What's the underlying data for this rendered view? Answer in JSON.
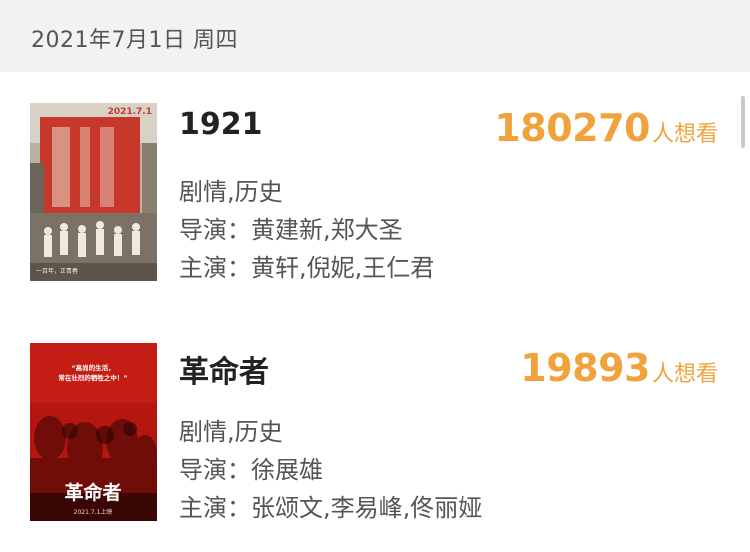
{
  "header": {
    "date": "2021年7月1日 周四"
  },
  "movies": [
    {
      "title": "1921",
      "want_count": "180270",
      "want_unit": "人想看",
      "genre": "剧情,历史",
      "director": "导演：黄建新,郑大圣",
      "cast": "主演：黄轩,倪妮,王仁君",
      "poster_text": {
        "date": "2021.7.1",
        "tag": "一百年，正青春"
      }
    },
    {
      "title": "革命者",
      "want_count": "19893",
      "want_unit": "人想看",
      "genre": "剧情,历史",
      "director": "导演：徐展雄",
      "cast": "主演：张颂文,李易峰,佟丽娅",
      "poster_text": {
        "title": "革命者",
        "quote1": "“高尚的生活，",
        "quote2": "常在壮烈的牺牲之中！”",
        "date": "2021.7.1上映"
      }
    }
  ],
  "colors": {
    "accent": "#f0a33c",
    "header_bg": "#f2f2f2",
    "text_dark": "#222222",
    "text_gray": "#555555"
  }
}
